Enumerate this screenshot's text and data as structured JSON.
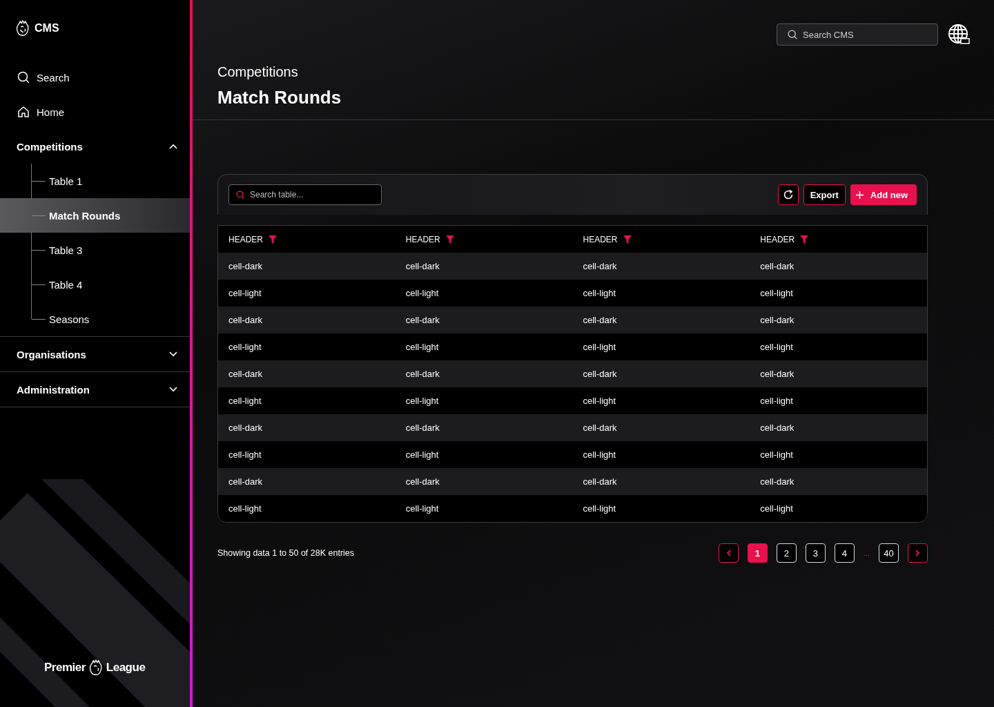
{
  "brand": {
    "title": "CMS"
  },
  "nav": [
    {
      "kind": "search",
      "label": "Search"
    },
    {
      "kind": "home",
      "label": "Home"
    }
  ],
  "groups": [
    {
      "label": "Competitions",
      "expanded": true,
      "children": [
        {
          "label": "Table 1",
          "selected": false
        },
        {
          "label": "Match Rounds",
          "selected": true
        },
        {
          "label": "Table 3",
          "selected": false
        },
        {
          "label": "Table 4",
          "selected": false
        },
        {
          "label": "Seasons",
          "selected": false
        }
      ]
    },
    {
      "label": "Organisations",
      "expanded": false
    },
    {
      "label": "Administration",
      "expanded": false
    }
  ],
  "footer_logo": {
    "left": "Premier",
    "right": "League"
  },
  "topbar": {
    "search": {
      "placeholder": "Search CMS"
    }
  },
  "page": {
    "breadcrumb": "Competitions",
    "title": "Match Rounds"
  },
  "toolbar": {
    "search": {
      "placeholder": "Search table..."
    },
    "export": "Export",
    "add": "Add new"
  },
  "table": {
    "columns": [
      "HEADER",
      "HEADER",
      "HEADER",
      "HEADER"
    ],
    "rows": [
      [
        "cell-dark",
        "cell-dark",
        "cell-dark",
        "cell-dark"
      ],
      [
        "cell-light",
        "cell-light",
        "cell-light",
        "cell-light"
      ],
      [
        "cell-dark",
        "cell-dark",
        "cell-dark",
        "cell-dark"
      ],
      [
        "cell-light",
        "cell-light",
        "cell-light",
        "cell-light"
      ],
      [
        "cell-dark",
        "cell-dark",
        "cell-dark",
        "cell-dark"
      ],
      [
        "cell-light",
        "cell-light",
        "cell-light",
        "cell-light"
      ],
      [
        "cell-dark",
        "cell-dark",
        "cell-dark",
        "cell-dark"
      ],
      [
        "cell-light",
        "cell-light",
        "cell-light",
        "cell-light"
      ],
      [
        "cell-dark",
        "cell-dark",
        "cell-dark",
        "cell-dark"
      ],
      [
        "cell-light",
        "cell-light",
        "cell-light",
        "cell-light"
      ]
    ]
  },
  "pagination": {
    "summary": "Showing data 1 to 50 of  28K entries",
    "pages": [
      {
        "kind": "page",
        "label": "1",
        "selected": true
      },
      {
        "kind": "page",
        "label": "2",
        "selected": false
      },
      {
        "kind": "page",
        "label": "3",
        "selected": false
      },
      {
        "kind": "page",
        "label": "4",
        "selected": false
      },
      {
        "kind": "ellipsis",
        "label": "..."
      },
      {
        "kind": "page",
        "label": "40",
        "selected": false
      }
    ]
  }
}
